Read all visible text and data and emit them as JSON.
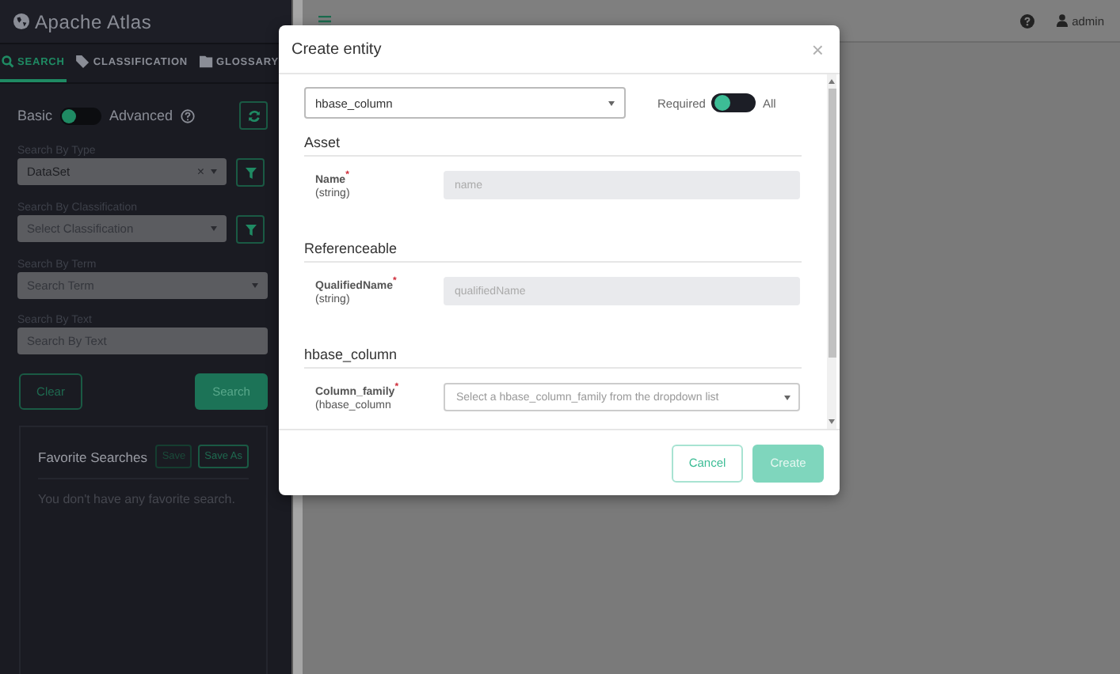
{
  "brand": "Apache Atlas",
  "tabs": [
    {
      "label": "SEARCH",
      "selected": true
    },
    {
      "label": "CLASSIFICATION",
      "selected": false
    },
    {
      "label": "GLOSSARY",
      "selected": false
    }
  ],
  "mode_toggle": {
    "left": "Basic",
    "right": "Advanced",
    "on": false
  },
  "filters": [
    {
      "label": "Search By Type",
      "kind": "select",
      "value": "DataSet",
      "clear": "×",
      "filter_button": true
    },
    {
      "label": "Search By Classification",
      "kind": "select",
      "placeholder": "Select Classification",
      "filter_button": true
    },
    {
      "label": "Search By Term",
      "kind": "select",
      "placeholder": "Search Term",
      "filter_button": false
    },
    {
      "label": "Search By Text",
      "kind": "input",
      "placeholder": "Search By Text",
      "filter_button": false
    }
  ],
  "actions": {
    "clear": "Clear",
    "search": "Search"
  },
  "favorites": {
    "title": "Favorite Searches",
    "save": "Save",
    "save_as": "Save As",
    "empty": "You don't have any favorite search."
  },
  "user": "admin",
  "modal": {
    "title": "Create entity",
    "close": "×",
    "type_value": "hbase_column",
    "attr_toggle": {
      "left": "Required",
      "right": "All",
      "on": false
    },
    "sections": [
      {
        "title": "Asset",
        "fields": [
          {
            "label": "Name$^{*}$",
            "type": "(string)",
            "kind": "input",
            "placeholder": "name"
          }
        ]
      },
      {
        "title": "Referenceable",
        "fields": [
          {
            "label": "QualifiedName$^{*}$",
            "type": "(string)",
            "kind": "input",
            "placeholder": "qualifiedName"
          }
        ]
      },
      {
        "title": "hbase_column",
        "fields": [
          {
            "label": "Column_family$^{*}$",
            "type": "(hbase_column",
            "kind": "select",
            "placeholder": "Select a hbase_column_family from the dropdown list"
          }
        ]
      }
    ],
    "cancel": "Cancel",
    "create": "Create"
  }
}
